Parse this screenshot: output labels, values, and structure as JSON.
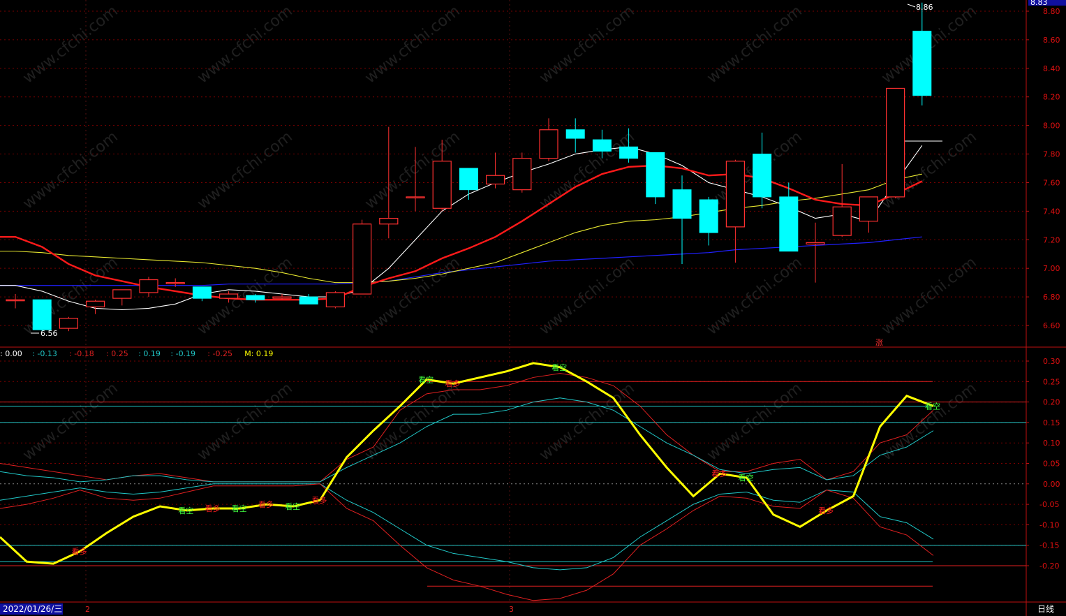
{
  "price_panel": {
    "price_ticks": [
      "8.80",
      "8.60",
      "8.40",
      "8.20",
      "8.00",
      "7.80",
      "7.60",
      "7.40",
      "7.20",
      "7.00",
      "6.80",
      "6.60"
    ],
    "current_price_badge": "8.83",
    "high_label": "8.86",
    "low_label": "6.56",
    "limit_up_marker": "涨"
  },
  "indicator_panel": {
    "legend": [
      {
        "text": ": 0.00",
        "color": "#ffffff"
      },
      {
        "text": ": -0.13",
        "color": "#21c8c8"
      },
      {
        "text": ": -0.18",
        "color": "#e02020"
      },
      {
        "text": ": 0.25",
        "color": "#e02020"
      },
      {
        "text": ": 0.19",
        "color": "#21c8c8"
      },
      {
        "text": ": -0.19",
        "color": "#21c8c8"
      },
      {
        "text": ": -0.25",
        "color": "#e02020"
      },
      {
        "text": "M: 0.19",
        "color": "#ffff00"
      }
    ],
    "ticks": [
      "0.30",
      "0.25",
      "0.20",
      "0.15",
      "0.10",
      "0.05",
      "0.00",
      "-0.05",
      "-0.10",
      "-0.15",
      "-0.20"
    ],
    "signal_bull": "看多",
    "signal_bear": "看空"
  },
  "bottom_bar": {
    "date": "2022/01/26/三",
    "month_marks": [
      "2",
      "3"
    ],
    "period": "日线"
  },
  "watermark": "www.cfchi.com",
  "colors": {
    "up": "#ff3030",
    "down": "#00ffff",
    "ma_white": "#ffffff",
    "ma_red": "#ff1a1a",
    "ma_yellow": "#e8e830",
    "ma_blue": "#2020ff",
    "m_line": "#ffff00",
    "grid": "#7a0000"
  },
  "chart_data": [
    {
      "type": "candlestick",
      "ylim": [
        6.5,
        8.9
      ],
      "candles": [
        {
          "o": 6.78,
          "h": 6.82,
          "l": 6.72,
          "c": 6.78
        },
        {
          "o": 6.78,
          "h": 6.78,
          "l": 6.56,
          "c": 6.57
        },
        {
          "o": 6.58,
          "h": 6.66,
          "l": 6.56,
          "c": 6.65
        },
        {
          "o": 6.73,
          "h": 6.78,
          "l": 6.68,
          "c": 6.77
        },
        {
          "o": 6.79,
          "h": 6.85,
          "l": 6.74,
          "c": 6.85
        },
        {
          "o": 6.83,
          "h": 6.94,
          "l": 6.8,
          "c": 6.92
        },
        {
          "o": 6.9,
          "h": 6.93,
          "l": 6.87,
          "c": 6.9
        },
        {
          "o": 6.87,
          "h": 6.87,
          "l": 6.77,
          "c": 6.79
        },
        {
          "o": 6.79,
          "h": 6.84,
          "l": 6.76,
          "c": 6.82
        },
        {
          "o": 6.81,
          "h": 6.82,
          "l": 6.76,
          "c": 6.78
        },
        {
          "o": 6.79,
          "h": 6.82,
          "l": 6.78,
          "c": 6.8
        },
        {
          "o": 6.8,
          "h": 6.82,
          "l": 6.75,
          "c": 6.75
        },
        {
          "o": 6.73,
          "h": 6.84,
          "l": 6.72,
          "c": 6.83
        },
        {
          "o": 6.82,
          "h": 7.34,
          "l": 6.82,
          "c": 7.31
        },
        {
          "o": 7.31,
          "h": 7.99,
          "l": 7.21,
          "c": 7.35
        },
        {
          "o": 7.5,
          "h": 7.85,
          "l": 7.4,
          "c": 7.5
        },
        {
          "o": 7.42,
          "h": 7.9,
          "l": 7.4,
          "c": 7.75
        },
        {
          "o": 7.7,
          "h": 7.7,
          "l": 7.48,
          "c": 7.55
        },
        {
          "o": 7.59,
          "h": 7.81,
          "l": 7.56,
          "c": 7.65
        },
        {
          "o": 7.55,
          "h": 7.81,
          "l": 7.53,
          "c": 7.77
        },
        {
          "o": 7.77,
          "h": 8.05,
          "l": 7.75,
          "c": 7.97
        },
        {
          "o": 7.97,
          "h": 8.05,
          "l": 7.81,
          "c": 7.91
        },
        {
          "o": 7.9,
          "h": 7.97,
          "l": 7.77,
          "c": 7.82
        },
        {
          "o": 7.85,
          "h": 7.98,
          "l": 7.74,
          "c": 7.77
        },
        {
          "o": 7.81,
          "h": 7.81,
          "l": 7.45,
          "c": 7.5
        },
        {
          "o": 7.55,
          "h": 7.65,
          "l": 7.03,
          "c": 7.35
        },
        {
          "o": 7.48,
          "h": 7.5,
          "l": 7.16,
          "c": 7.25
        },
        {
          "o": 7.29,
          "h": 7.76,
          "l": 7.04,
          "c": 7.75
        },
        {
          "o": 7.8,
          "h": 7.95,
          "l": 7.42,
          "c": 7.5
        },
        {
          "o": 7.5,
          "h": 7.6,
          "l": 7.12,
          "c": 7.12
        },
        {
          "o": 7.17,
          "h": 7.32,
          "l": 6.9,
          "c": 7.18
        },
        {
          "o": 7.23,
          "h": 7.73,
          "l": 7.22,
          "c": 7.43
        },
        {
          "o": 7.33,
          "h": 7.5,
          "l": 7.25,
          "c": 7.5
        },
        {
          "o": 7.5,
          "h": 8.26,
          "l": 7.49,
          "c": 8.26
        },
        {
          "o": 8.66,
          "h": 8.86,
          "l": 8.14,
          "c": 8.21
        }
      ],
      "ma": {
        "white": [
          6.88,
          6.84,
          6.77,
          6.72,
          6.71,
          6.72,
          6.75,
          6.82,
          6.85,
          6.84,
          6.82,
          6.8,
          6.8,
          6.85,
          7.0,
          7.2,
          7.4,
          7.52,
          7.6,
          7.67,
          7.73,
          7.8,
          7.83,
          7.85,
          7.8,
          7.72,
          7.6,
          7.55,
          7.5,
          7.43,
          7.35,
          7.38,
          7.33,
          7.6,
          7.86
        ],
        "red": [
          7.22,
          7.15,
          7.03,
          6.95,
          6.91,
          6.87,
          6.84,
          6.81,
          6.79,
          6.78,
          6.78,
          6.78,
          6.79,
          6.87,
          6.93,
          6.98,
          7.07,
          7.14,
          7.22,
          7.33,
          7.45,
          7.57,
          7.66,
          7.71,
          7.72,
          7.7,
          7.65,
          7.66,
          7.63,
          7.56,
          7.48,
          7.45,
          7.44,
          7.52,
          7.61
        ],
        "yellow": [
          7.12,
          7.11,
          7.09,
          7.08,
          7.07,
          7.06,
          7.05,
          7.04,
          7.02,
          7.0,
          6.97,
          6.93,
          6.9,
          6.9,
          6.91,
          6.93,
          6.96,
          7.0,
          7.04,
          7.11,
          7.18,
          7.25,
          7.3,
          7.33,
          7.34,
          7.36,
          7.39,
          7.42,
          7.44,
          7.47,
          7.49,
          7.52,
          7.55,
          7.62,
          7.66
        ],
        "blue": [
          6.88,
          6.88,
          6.88,
          6.88,
          6.88,
          6.88,
          6.88,
          6.88,
          6.89,
          6.89,
          6.89,
          6.89,
          6.89,
          6.9,
          6.91,
          6.94,
          6.97,
          6.99,
          7.01,
          7.03,
          7.05,
          7.06,
          7.07,
          7.08,
          7.09,
          7.1,
          7.11,
          7.13,
          7.14,
          7.15,
          7.16,
          7.17,
          7.18,
          7.2,
          7.22
        ]
      }
    },
    {
      "type": "line",
      "ylim": [
        -0.3,
        0.33
      ],
      "series": [
        {
          "name": "M",
          "color": "#ffff00",
          "values": [
            -0.13,
            -0.19,
            -0.195,
            -0.165,
            -0.12,
            -0.08,
            -0.055,
            -0.065,
            -0.06,
            -0.06,
            -0.05,
            -0.055,
            -0.04,
            0.065,
            0.13,
            0.19,
            0.255,
            0.245,
            0.26,
            0.275,
            0.295,
            0.285,
            0.25,
            0.21,
            0.12,
            0.04,
            -0.03,
            0.025,
            0.015,
            -0.075,
            -0.105,
            -0.065,
            -0.03,
            0.14,
            0.215,
            0.19
          ]
        },
        {
          "color": "#e02020",
          "values": [
            0.05,
            0.04,
            0.03,
            0.02,
            0.01,
            0.02,
            0.025,
            0.015,
            0.005,
            0.005,
            0.005,
            0.005,
            0.005,
            0.06,
            0.09,
            0.18,
            0.22,
            0.23,
            0.23,
            0.24,
            0.26,
            0.27,
            0.26,
            0.24,
            0.19,
            0.12,
            0.07,
            0.03,
            0.03,
            0.05,
            0.06,
            0.01,
            0.03,
            0.1,
            0.12,
            0.18
          ]
        },
        {
          "color": "#21c8c8",
          "values": [
            0.03,
            0.02,
            0.015,
            0.005,
            0.01,
            0.02,
            0.02,
            0.01,
            0.005,
            0.005,
            0.005,
            0.005,
            0.005,
            0.04,
            0.07,
            0.1,
            0.14,
            0.17,
            0.17,
            0.18,
            0.2,
            0.21,
            0.2,
            0.18,
            0.14,
            0.1,
            0.07,
            0.035,
            0.025,
            0.035,
            0.04,
            0.01,
            0.02,
            0.07,
            0.09,
            0.13
          ]
        },
        {
          "color": "#21c8c8",
          "values": [
            -0.04,
            -0.03,
            -0.02,
            -0.01,
            -0.02,
            -0.025,
            -0.02,
            -0.01,
            0.0,
            0.0,
            0.0,
            0.0,
            0.0,
            -0.04,
            -0.07,
            -0.11,
            -0.15,
            -0.17,
            -0.18,
            -0.19,
            -0.205,
            -0.21,
            -0.205,
            -0.18,
            -0.13,
            -0.09,
            -0.05,
            -0.025,
            -0.02,
            -0.04,
            -0.045,
            -0.015,
            -0.02,
            -0.08,
            -0.095,
            -0.135
          ]
        },
        {
          "color": "#e02020",
          "values": [
            -0.06,
            -0.05,
            -0.035,
            -0.015,
            -0.035,
            -0.04,
            -0.035,
            -0.02,
            -0.005,
            -0.005,
            -0.005,
            -0.005,
            0.0,
            -0.06,
            -0.09,
            -0.15,
            -0.205,
            -0.235,
            -0.25,
            -0.27,
            -0.285,
            -0.28,
            -0.26,
            -0.22,
            -0.15,
            -0.11,
            -0.065,
            -0.03,
            -0.035,
            -0.055,
            -0.06,
            -0.015,
            -0.035,
            -0.105,
            -0.125,
            -0.175
          ]
        }
      ],
      "levels": [
        {
          "value": 0.25,
          "color": "#e02020"
        },
        {
          "value": 0.2,
          "color": "#e02020"
        },
        {
          "value": 0.19,
          "color": "#21c8c8"
        },
        {
          "value": 0.15,
          "color": "#21c8c8"
        },
        {
          "value": -0.15,
          "color": "#21c8c8"
        },
        {
          "value": -0.19,
          "color": "#21c8c8"
        },
        {
          "value": -0.2,
          "color": "#e02020"
        },
        {
          "value": -0.25,
          "color": "#e02020"
        }
      ],
      "signals": [
        {
          "i": 3,
          "type": "bull"
        },
        {
          "i": 16,
          "type": "bear"
        },
        {
          "i": 17,
          "type": "bull"
        },
        {
          "i": 21,
          "type": "bear"
        },
        {
          "i": 7,
          "type": "bear"
        },
        {
          "i": 8,
          "type": "bull"
        },
        {
          "i": 9,
          "type": "bear"
        },
        {
          "i": 10,
          "type": "bull"
        },
        {
          "i": 11,
          "type": "bear"
        },
        {
          "i": 12,
          "type": "bull"
        },
        {
          "i": 27,
          "type": "bull"
        },
        {
          "i": 28,
          "type": "bear"
        },
        {
          "i": 31,
          "type": "bull"
        },
        {
          "i": 35,
          "type": "bear"
        }
      ]
    }
  ]
}
